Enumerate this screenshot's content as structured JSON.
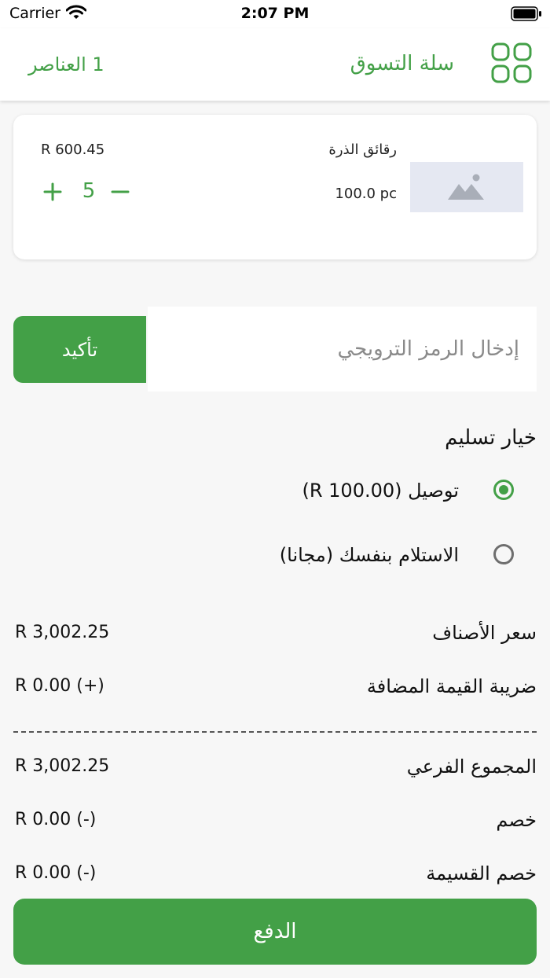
{
  "status_bar": {
    "carrier": "Carrier",
    "time": "2:07 PM"
  },
  "header": {
    "title": "سلة التسوق",
    "items_count": "1 العناصر",
    "menu_icon": "grid-icon"
  },
  "cart": {
    "items": [
      {
        "name": "رقائق الذرة",
        "unit": "100.0 pc",
        "price": "R 600.45",
        "quantity": "5",
        "image_icon": "image-placeholder-icon"
      }
    ]
  },
  "promo": {
    "placeholder": "إدخال الرمز الترويجي",
    "value": "",
    "confirm_label": "تأكيد"
  },
  "delivery": {
    "title": "خيار تسليم",
    "options": [
      {
        "label": "توصيل (R 100.00)",
        "selected": true
      },
      {
        "label": "الاستلام بنفسك  (مجانا)",
        "selected": false
      }
    ]
  },
  "summary": {
    "items_price": {
      "label": "سعر الأصناف",
      "value": "R 3,002.25"
    },
    "vat": {
      "label": "ضريبة القيمة المضافة",
      "value": "R 0.00 (+)"
    },
    "subtotal": {
      "label": "المجموع الفرعي",
      "value": "R 3,002.25"
    },
    "discount": {
      "label": "خصم",
      "value": "R 0.00 (-)"
    },
    "coupon_discount": {
      "label": "خصم القسيمة",
      "value": "R 0.00 (-)"
    }
  },
  "pay_label": "الدفع",
  "colors": {
    "accent": "#43a047",
    "background": "#f7f7f7",
    "card": "#ffffff",
    "image_placeholder": "#e5e8f2"
  }
}
